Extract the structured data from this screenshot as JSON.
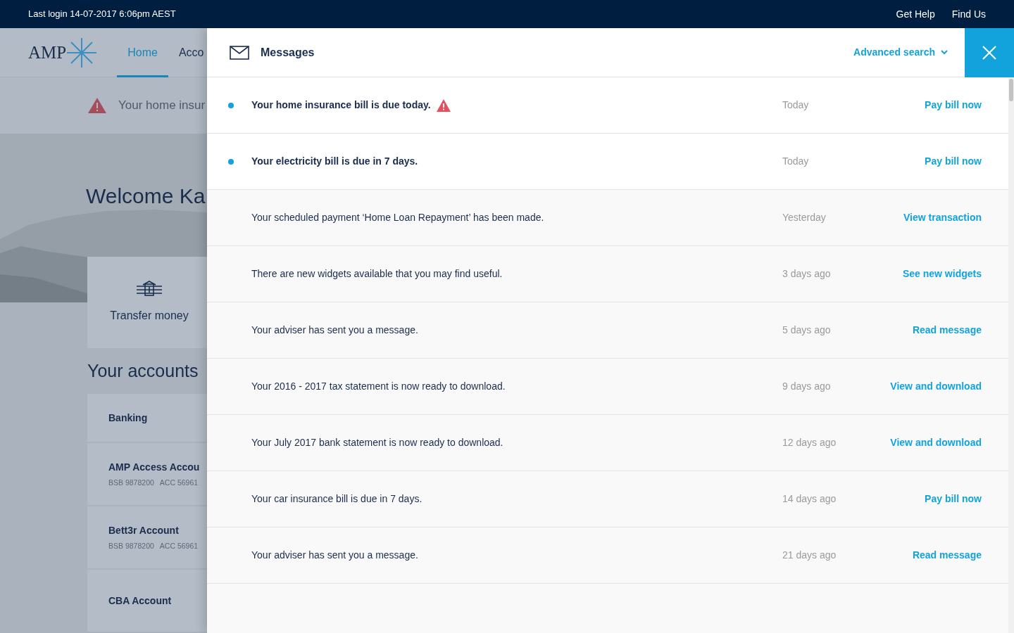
{
  "top_bar": {
    "last_login": "Last login 14-07-2017 6:06pm AEST",
    "links": [
      "Get Help",
      "Find Us"
    ]
  },
  "logo": {
    "text": "AMP"
  },
  "nav": {
    "tabs": [
      {
        "label": "Home",
        "selected": true
      },
      {
        "label": "Acco",
        "selected": false
      }
    ]
  },
  "alert_banner": {
    "text": "Your home insur"
  },
  "welcome": {
    "title": "Welcome Ka"
  },
  "quick_action": {
    "label": "Transfer money"
  },
  "accounts": {
    "title": "Your accounts",
    "group": "Banking",
    "items": [
      {
        "name": "AMP Access Accou",
        "bsb": "BSB 9878200",
        "acc": "ACC 56961"
      },
      {
        "name": "Bett3r Account",
        "bsb": "BSB 9878200",
        "acc": "ACC 56961"
      },
      {
        "name": "CBA Account"
      }
    ]
  },
  "messages_panel": {
    "title": "Messages",
    "advanced_search": "Advanced search",
    "messages": [
      {
        "text": "Your home insurance bill is due today.",
        "unread": true,
        "alert": true,
        "time": "Today",
        "action": "Pay bill now"
      },
      {
        "text": "Your electricity bill is due in 7 days.",
        "unread": true,
        "alert": false,
        "time": "Today",
        "action": "Pay bill now"
      },
      {
        "text": "Your scheduled payment ‘Home Loan Repayment’ has been made.",
        "unread": false,
        "alert": false,
        "time": "Yesterday",
        "action": "View transaction"
      },
      {
        "text": "There are new widgets available that you may find useful.",
        "unread": false,
        "alert": false,
        "time": "3 days ago",
        "action": "See new widgets"
      },
      {
        "text": "Your adviser has sent you a message.",
        "unread": false,
        "alert": false,
        "time": "5 days ago",
        "action": "Read message"
      },
      {
        "text": "Your 2016 - 2017 tax statement is now ready to download.",
        "unread": false,
        "alert": false,
        "time": "9 days ago",
        "action": "View and download"
      },
      {
        "text": "Your July 2017 bank statement is now ready to download.",
        "unread": false,
        "alert": false,
        "time": "12 days ago",
        "action": "View and download"
      },
      {
        "text": "Your car insurance bill is due in 7 days.",
        "unread": false,
        "alert": false,
        "time": "14 days ago",
        "action": "Pay bill now"
      },
      {
        "text": "Your adviser has sent you a message.",
        "unread": false,
        "alert": false,
        "time": "21 days ago",
        "action": "Read message"
      }
    ]
  }
}
